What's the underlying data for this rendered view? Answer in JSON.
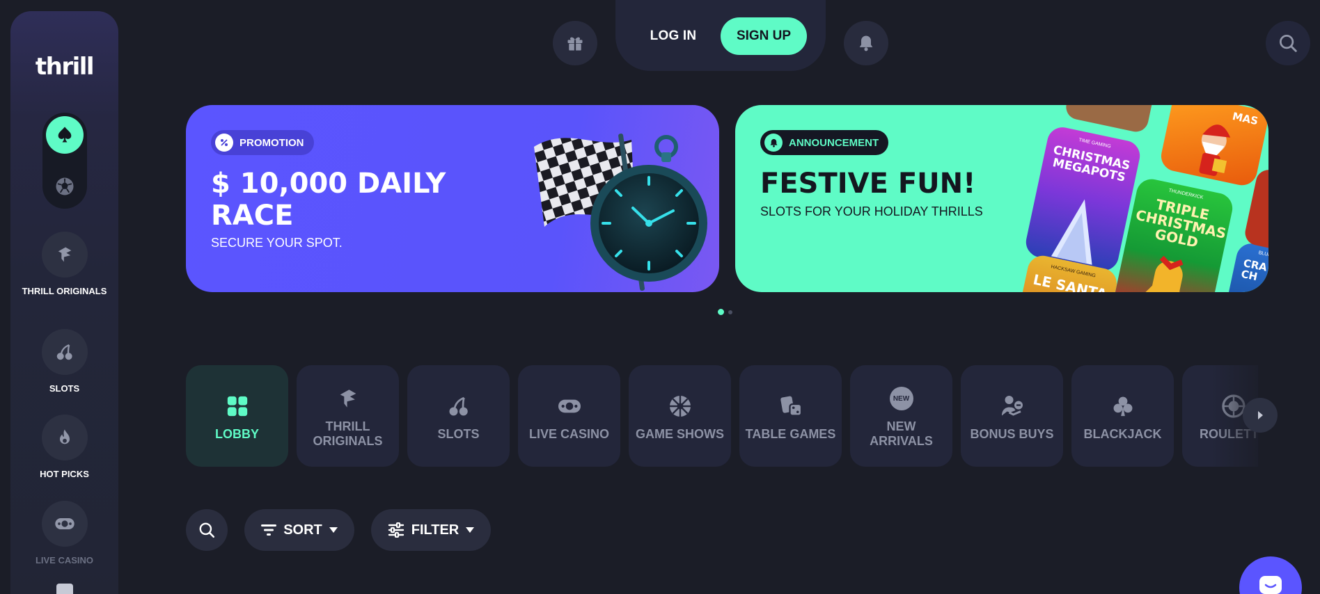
{
  "colors": {
    "background": "#1b1d27",
    "accent": "#5ffbc6",
    "promo": "#5b55ff",
    "surface": "#23263a"
  },
  "sidebar": {
    "logo": "thrill",
    "mode_toggle": {
      "active": "casino",
      "options": [
        "spade-icon",
        "football-icon"
      ]
    },
    "items": [
      {
        "label": "THRILL ORIGINALS",
        "icon": "originals-icon"
      },
      {
        "label": "SLOTS",
        "icon": "cherries-icon"
      },
      {
        "label": "HOT PICKS",
        "icon": "flame-icon"
      },
      {
        "label": "LIVE CASINO",
        "icon": "live-chip-icon"
      }
    ]
  },
  "header": {
    "login": "LOG IN",
    "signup": "SIGN UP",
    "icons": [
      "gift-icon",
      "bell-icon",
      "search-icon"
    ]
  },
  "banners": [
    {
      "tag": "PROMOTION",
      "title": "$ 10,000 DAILY RACE",
      "subtitle": "SECURE YOUR SPOT."
    },
    {
      "tag": "ANNOUNCEMENT",
      "title": "FESTIVE FUN!",
      "subtitle": "SLOTS FOR YOUR HOLIDAY THRILLS",
      "game_tiles": [
        {
          "provider": "TIME GAMING",
          "name": "CHRISTMAS MEGAPOTS"
        },
        {
          "provider": "THUNDERKICK",
          "name": "TRIPLE CHRISTMAS GOLD"
        },
        {
          "provider": "HACKSAW GAMING",
          "name": "LE SANTA"
        },
        {
          "provider": "",
          "name": "MAS"
        },
        {
          "provider": "BLUE",
          "name": "CRA CH"
        }
      ]
    }
  ],
  "carousel": {
    "active_index": 0,
    "count": 2
  },
  "categories": [
    {
      "label": "LOBBY",
      "icon": "grid-icon",
      "active": true
    },
    {
      "label": "THRILL ORIGINALS",
      "icon": "originals-icon",
      "active": false
    },
    {
      "label": "SLOTS",
      "icon": "cherries-icon",
      "active": false
    },
    {
      "label": "LIVE CASINO",
      "icon": "live-chip-icon",
      "active": false
    },
    {
      "label": "GAME SHOWS",
      "icon": "wheel-icon",
      "active": false
    },
    {
      "label": "TABLE GAMES",
      "icon": "cards-dice-icon",
      "active": false
    },
    {
      "label": "NEW ARRIVALS",
      "icon": "new-badge-icon",
      "active": false
    },
    {
      "label": "BONUS BUYS",
      "icon": "bonus-buy-icon",
      "active": false
    },
    {
      "label": "BLACKJACK",
      "icon": "club-icon",
      "active": false
    },
    {
      "label": "ROULETTE",
      "icon": "roulette-icon",
      "active": false
    }
  ],
  "new_badge_text": "NEW",
  "toolbar": {
    "sort": "SORT",
    "filter": "FILTER"
  }
}
